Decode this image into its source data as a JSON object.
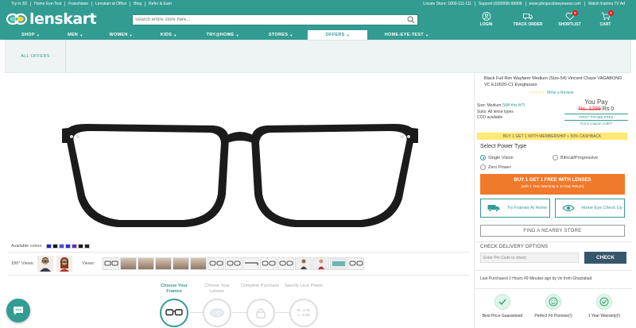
{
  "topbar": {
    "left": [
      "Try in 3D",
      "Home Eye-Test",
      "Franchisee",
      "Lenskart at Office",
      "Blog",
      "Refer & Earn"
    ],
    "right": [
      "Locate Store: 1800-111-111",
      "Support:(0)99998-99998",
      "www.johnjacobseyewear.com",
      "Watch Katrina TV Ad"
    ]
  },
  "header": {
    "logo_text": "lenskart",
    "search_placeholder": "Search entire store here...",
    "icons": [
      {
        "label": "LOGIN",
        "icon": "user-icon"
      },
      {
        "label": "TRACK ORDER",
        "icon": "truck-icon"
      },
      {
        "label": "SHORTLIST",
        "icon": "heart-icon",
        "badge": "0"
      },
      {
        "label": "CART",
        "icon": "cart-icon",
        "badge": "0"
      }
    ]
  },
  "nav": {
    "items": [
      "SHOP",
      "MEN",
      "WOMEN",
      "KIDS",
      "TRY@HOME",
      "STORES",
      "OFFERS",
      "HOME-EYE-TEST"
    ],
    "active": "OFFERS"
  },
  "subbar": {
    "all_offers": "ALL OFFERS"
  },
  "product": {
    "colors_label": "Available colors",
    "swatches": [
      "#1f1fd6",
      "#141414",
      "#4a4ae6",
      "#2f2fcc",
      "#5a2bd8",
      "#1a1a1a",
      "#222222"
    ],
    "views_label": "180° Views:",
    "views_label2": "Views:"
  },
  "steps": [
    {
      "label": "Choose Your Frames",
      "active": true
    },
    {
      "label": "Choose Your Lenses",
      "active": false
    },
    {
      "label": "Complete Purchase",
      "active": false
    },
    {
      "label": "Specify Lens Power",
      "active": false,
      "power_r": "R: -2.75",
      "power_l": "L: -3.00"
    }
  ],
  "panel": {
    "title": "Black Full Rim Wayfarer Medium (Size-54) Vincent Chase VAGABOND VC E10620-C1 Eyeglasses",
    "stars": "☆☆☆☆☆",
    "review": "Write a Review",
    "size_label": "Size:",
    "size_value": "Medium",
    "size_link": "(Will this fit?)",
    "suits_label": "Suits:",
    "suits_value": "All lense types",
    "cod": "COD available",
    "you_pay": "You Pay",
    "old_price": "Rs. 1299",
    "new_price": "Rs 0",
    "first_frame": "FIRST FRAME FREE",
    "coupon": "Got a coupon code?",
    "promo": "BUY 1 GET 1 WITH MEMBERSHIP + 50% CASHBACK",
    "power_title": "Select Power Type",
    "power_options": [
      "Single Vision",
      "Bifocal/Progressive",
      "Zero Power"
    ],
    "buy_main": "BUY 1 GET 1 FREE WITH LENSES",
    "buy_sub": "(with 1 Year Warranty & 14 Day Return)",
    "try_frames": "Try Frames At Home",
    "eye_check": "Home Eye Check Up",
    "find_store": "FIND A NEARBY STORE",
    "delivery_title": "CHECK DELIVERY OPTIONS",
    "pin_placeholder": "Enter Pin Code to check",
    "check": "CHECK",
    "purchased": "Last Purchased 2 Hours 49 Minutes ago by viv from Ghaziabad",
    "guarantees": [
      {
        "label": "Best Price Guaranteed",
        "icon": "check-icon"
      },
      {
        "label": "Perfect Fit Promise(!)",
        "icon": "smile-icon"
      },
      {
        "label": "1 Year Warranty(!)",
        "icon": "shield-check-icon"
      }
    ]
  },
  "colors": {
    "brand": "#329c92",
    "orange": "#ef7a2c",
    "check_btn": "#37566a",
    "promo_bg": "#ffe873"
  }
}
